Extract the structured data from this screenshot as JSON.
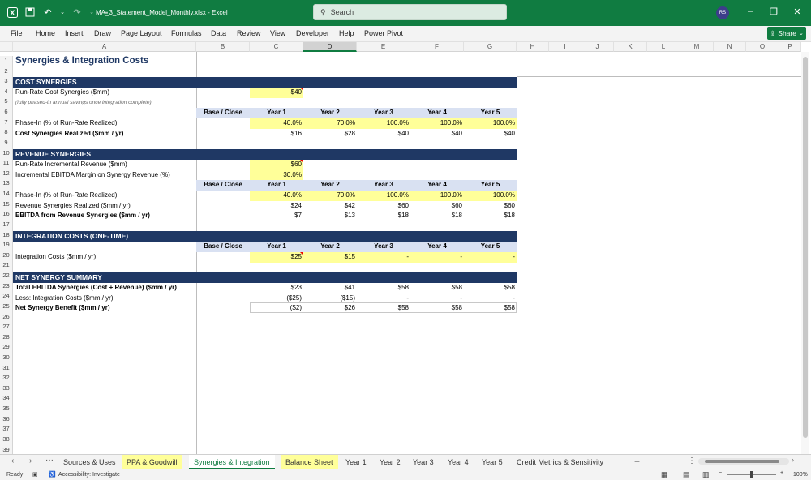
{
  "app": {
    "doc_title": "MA_3_Statement_Model_Monthly.xlsx  -  Excel",
    "search_placeholder": "Search",
    "avatar_initials": "RS",
    "brand_color": "#107c41"
  },
  "menu": [
    "File",
    "Home",
    "Insert",
    "Draw",
    "Page Layout",
    "Formulas",
    "Data",
    "Review",
    "View",
    "Developer",
    "Help",
    "Power Pivot"
  ],
  "share_label": "Share",
  "columns": [
    "A",
    "B",
    "C",
    "D",
    "E",
    "F",
    "G",
    "H",
    "I",
    "J",
    "K",
    "L",
    "M",
    "N",
    "O",
    "P"
  ],
  "rows": [
    "1",
    "2",
    "3",
    "4",
    "5",
    "6",
    "7",
    "8",
    "9",
    "10",
    "11",
    "12",
    "13",
    "14",
    "15",
    "16",
    "17",
    "18",
    "19",
    "20",
    "21",
    "22",
    "23",
    "24",
    "25",
    "26",
    "27",
    "28",
    "29",
    "30",
    "31",
    "32",
    "33",
    "34",
    "35",
    "36",
    "37",
    "38",
    "39"
  ],
  "sheet": {
    "title": "Synergies & Integration Costs",
    "cost": {
      "header": "COST SYNERGIES",
      "runrate_label": "Run-Rate Cost Synergies ($mm)",
      "runrate_value": "$40",
      "note": "(fully phased-in annual savings once integration complete)",
      "phase_label": "Phase-In (% of Run-Rate Realized)",
      "realized_label": "Cost Synergies Realized ($mm / yr)",
      "phase": [
        "40.0%",
        "70.0%",
        "100.0%",
        "100.0%",
        "100.0%"
      ],
      "realized": [
        "$16",
        "$28",
        "$40",
        "$40",
        "$40"
      ]
    },
    "period_header": [
      "Base / Close",
      "Year 1",
      "Year 2",
      "Year 3",
      "Year 4",
      "Year 5"
    ],
    "revenue": {
      "header": "REVENUE SYNERGIES",
      "runrate_label": "Run-Rate Incremental Revenue ($mm)",
      "runrate_value": "$60",
      "margin_label": "Incremental EBITDA Margin on Synergy Revenue (%)",
      "margin_value": "30.0%",
      "phase_label": "Phase-In (% of Run-Rate Realized)",
      "phase": [
        "40.0%",
        "70.0%",
        "100.0%",
        "100.0%",
        "100.0%"
      ],
      "realized_label": "Revenue Synergies Realized ($mm / yr)",
      "realized": [
        "$24",
        "$42",
        "$60",
        "$60",
        "$60"
      ],
      "ebitda_label": "EBITDA from Revenue Synergies ($mm / yr)",
      "ebitda": [
        "$7",
        "$13",
        "$18",
        "$18",
        "$18"
      ]
    },
    "integration": {
      "header": "INTEGRATION COSTS (ONE-TIME)",
      "label": "Integration Costs ($mm / yr)",
      "values": [
        "$25",
        "$15",
        "-",
        "-",
        "-"
      ]
    },
    "net": {
      "header": "NET SYNERGY SUMMARY",
      "total_label": "Total EBITDA Synergies (Cost + Revenue) ($mm / yr)",
      "total": [
        "$23",
        "$41",
        "$58",
        "$58",
        "$58"
      ],
      "less_label": "Less: Integration Costs ($mm / yr)",
      "less": [
        "($25)",
        "($15)",
        "-",
        "-",
        "-"
      ],
      "benefit_label": "Net Synergy Benefit ($mm / yr)",
      "benefit": [
        "($2)",
        "$26",
        "$58",
        "$58",
        "$58"
      ]
    }
  },
  "tabs": [
    "Sources & Uses",
    "PPA & Goodwill",
    "Synergies & Integration",
    "Balance Sheet",
    "Year 1",
    "Year 2",
    "Year 3",
    "Year 4",
    "Year 5",
    "Credit Metrics & Sensitivity"
  ],
  "status": {
    "ready": "Ready",
    "accessibility": "Accessibility: Investigate",
    "zoom": "100%"
  }
}
